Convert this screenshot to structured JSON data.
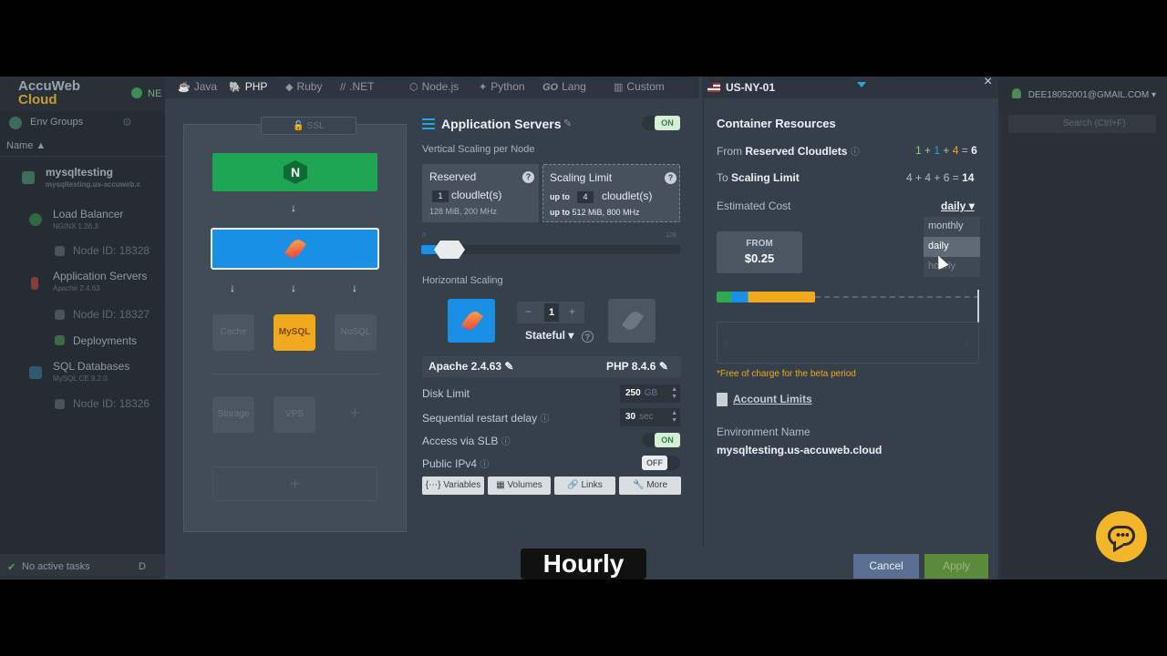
{
  "app": {
    "logo_line1": "AccuWeb",
    "logo_line2": "Cloud",
    "new_label": "NE",
    "user_email": "DEE18052001@GMAIL.COM",
    "search_placeholder": "Search (Ctrl+F)",
    "env_groups_label": "Env Groups",
    "name_column": "Name ▲",
    "status_text": "No active tasks",
    "status_tail": "D"
  },
  "tree": {
    "env_name": "mysqltesting",
    "env_domain": "mysqltesting.us-accuweb.c",
    "load_balancer": "Load Balancer",
    "load_balancer_ver": "NGINX 1.26.3",
    "lb_node": "Node ID: 18328",
    "app_servers": "Application Servers",
    "app_servers_ver": "Apache 2.4.63",
    "app_node": "Node ID: 18327",
    "deployments": "Deployments",
    "sql_db": "SQL Databases",
    "sql_db_ver": "MySQL CE 9.2.0",
    "sql_node": "Node ID: 18326"
  },
  "tabs": [
    {
      "label": "Java",
      "icon": "java-icon"
    },
    {
      "label": "PHP",
      "icon": "php-icon"
    },
    {
      "label": "Ruby",
      "icon": "ruby-icon"
    },
    {
      "label": ".NET",
      "icon": "dotnet-icon"
    },
    {
      "label": "Node.js",
      "icon": "nodejs-icon"
    },
    {
      "label": "Python",
      "icon": "python-icon"
    },
    {
      "label": "Lang",
      "prefix": "GO",
      "icon": "go-icon"
    },
    {
      "label": "Custom",
      "icon": "custom-icon"
    }
  ],
  "region": {
    "label": "US-NY-01"
  },
  "topology": {
    "ssl": "SSL",
    "nginx_letter": "N",
    "cache": "Cache",
    "mysql": "MySQL",
    "nosql": "NoSQL",
    "storage": "Storage",
    "vps": "VPS"
  },
  "config": {
    "title": "Application Servers",
    "title_toggle": "ON",
    "vertical_label": "Vertical Scaling per Node",
    "reserved_label": "Reserved",
    "reserved_value": "1",
    "reserved_unit": "cloudlet(s)",
    "reserved_spec": "128 MiB, 200 MHz",
    "limit_label": "Scaling Limit",
    "limit_prefix": "up to",
    "limit_value": "4",
    "limit_unit": "cloudlet(s)",
    "limit_spec_prefix": "up to",
    "limit_spec": "512 MiB, 800 MHz",
    "slider_min": "0",
    "slider_max": "128",
    "horizontal_label": "Horizontal Scaling",
    "node_count": "1",
    "node_count_value": 1,
    "stateful_label": "Stateful",
    "server_version": "Apache 2.4.63",
    "php_version": "PHP 8.4.6",
    "disk_limit_label": "Disk Limit",
    "disk_limit_value": "250",
    "disk_limit_unit": "GB",
    "restart_label": "Sequential restart delay",
    "restart_value": "30",
    "restart_unit": "sec",
    "slb_label": "Access via SLB",
    "slb_toggle": "ON",
    "ipv4_label": "Public IPv4",
    "ipv4_toggle": "OFF",
    "btn_variables": "{⋯} Variables",
    "btn_volumes": "Volumes",
    "btn_links": "Links",
    "btn_more": "More"
  },
  "resources": {
    "title": "Container Resources",
    "from_label": "From",
    "from_bold": "Reserved Cloudlets",
    "from_a": "1",
    "from_b": "1",
    "from_c": "4",
    "from_total": "6",
    "to_label": "To",
    "to_bold": "Scaling Limit",
    "to_expr": "4 + 4 + 6 =",
    "to_total": "14",
    "cost_label": "Estimated Cost",
    "cost_period": "daily",
    "price_from": "FROM",
    "price_value": "$0.25",
    "free_note": "*Free of charge for the beta period",
    "account_limits": "Account Limits",
    "env_name_label": "Environment Name",
    "env_name_value": "mysqltesting.us-accuweb.cloud",
    "period_options": [
      "monthly",
      "daily",
      "hourly"
    ],
    "hovered_partial": "hourly"
  },
  "footer": {
    "cancel": "Cancel",
    "apply": "Apply"
  },
  "caption": "Hourly",
  "colors": {
    "accent_blue": "#1a8fe6",
    "nginx_green": "#1fa654",
    "mysql_orange": "#f0a81c",
    "chat_yellow": "#f3b52a"
  }
}
